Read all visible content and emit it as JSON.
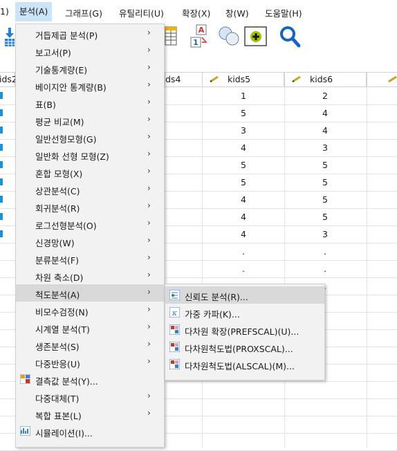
{
  "menubar": {
    "items": [
      "1)",
      "분석(A)",
      "그래프(G)",
      "유틸리티(U)",
      "확장(X)",
      "창(W)",
      "도움말(H)"
    ]
  },
  "columns": {
    "left_partial": "ids2",
    "mid_partial": "ds4",
    "kids5": "kids5",
    "kids6": "kids6"
  },
  "data": {
    "kids5": [
      "1",
      "5",
      "3",
      "4",
      "5",
      "5",
      "4",
      "4",
      "4",
      ".",
      ".",
      "."
    ],
    "kids6": [
      "2",
      "4",
      "4",
      "3",
      "5",
      "5",
      "5",
      "5",
      "3",
      ".",
      ".",
      "."
    ]
  },
  "analyze_menu": {
    "items": [
      {
        "label": "거듭제곱 분석(P)",
        "arrow": "›"
      },
      {
        "label": "보고서(P)",
        "arrow": "›"
      },
      {
        "label": "기술통계량(E)",
        "arrow": "›"
      },
      {
        "label": "베이지안 통계량(B)",
        "arrow": "›"
      },
      {
        "label": "표(B)",
        "arrow": "›"
      },
      {
        "label": "평균 비교(M)",
        "arrow": "›"
      },
      {
        "label": "일반선형모형(G)",
        "arrow": "›"
      },
      {
        "label": "일반화 선형 모형(Z)",
        "arrow": "›"
      },
      {
        "label": "혼합 모형(X)",
        "arrow": "›"
      },
      {
        "label": "상관분석(C)",
        "arrow": "›"
      },
      {
        "label": "회귀분석(R)",
        "arrow": "›"
      },
      {
        "label": "로그선형분석(O)",
        "arrow": "›"
      },
      {
        "label": "신경망(W)",
        "arrow": "›"
      },
      {
        "label": "분류분석(F)",
        "arrow": "›"
      },
      {
        "label": "차원 축소(D)",
        "arrow": "›"
      },
      {
        "label": "척도분석(A)",
        "arrow": "›"
      },
      {
        "label": "비모수검정(N)",
        "arrow": "›"
      },
      {
        "label": "시계열 분석(T)",
        "arrow": "›"
      },
      {
        "label": "생존분석(S)",
        "arrow": "›"
      },
      {
        "label": "다중반응(U)",
        "arrow": "›"
      },
      {
        "label": "결측값 분석(Y)...",
        "arrow": ""
      },
      {
        "label": "다중대체(T)",
        "arrow": "›"
      },
      {
        "label": "복합 표본(L)",
        "arrow": "›"
      },
      {
        "label": "시뮬레이션(I)...",
        "arrow": ""
      }
    ]
  },
  "scale_submenu": {
    "items": [
      "신뢰도 분석(R)...",
      "가중 카파(K)...",
      "다차원 확장(PREFSCAL)(U)...",
      "다차원척도법(PROXSCAL)...",
      "다차원척도법(ALSCAL)(M)..."
    ]
  },
  "colors": {
    "highlight": "#d9d9d9",
    "menubar_active": "#cce4f7",
    "menu_bg": "#f2f2f2",
    "search_icon": "#1565c0"
  }
}
